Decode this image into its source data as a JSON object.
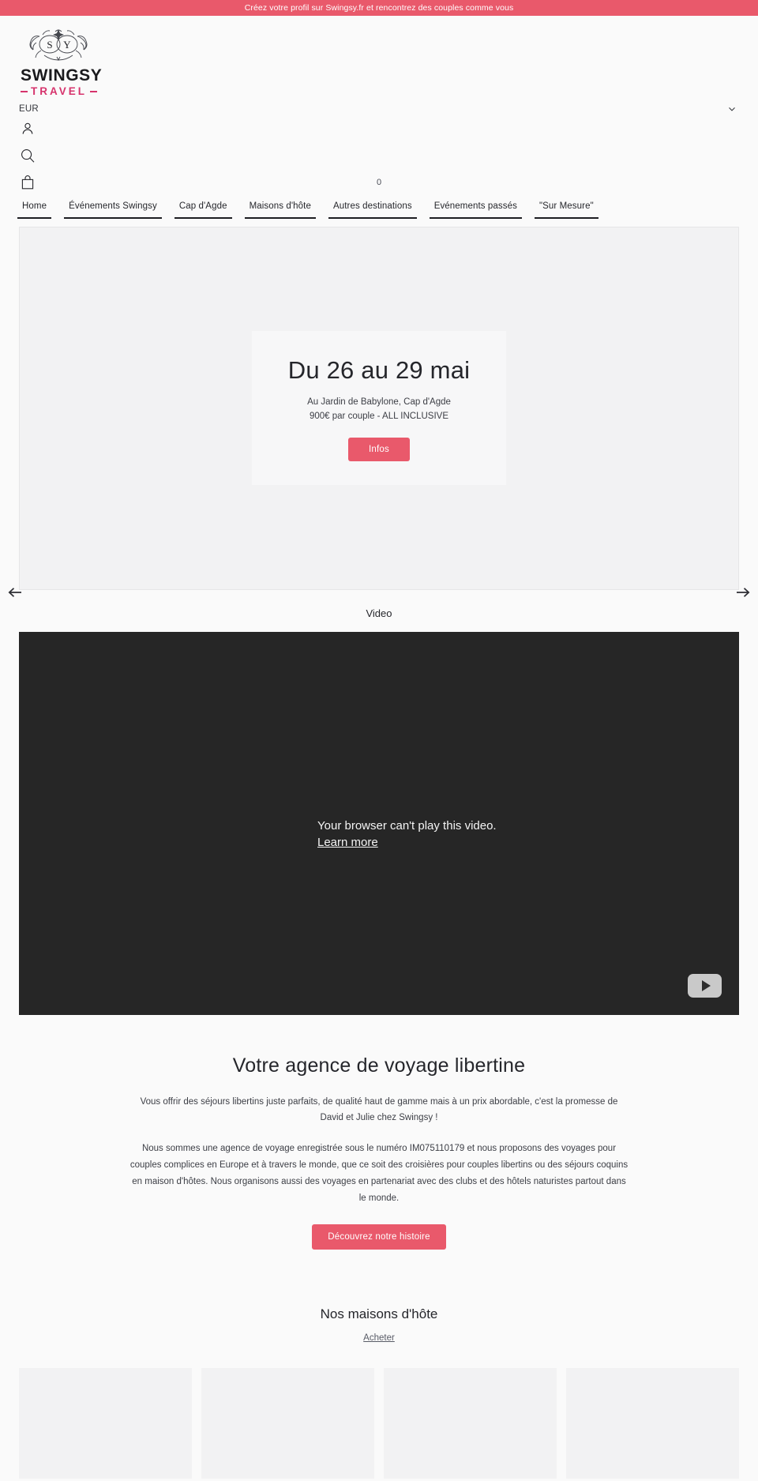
{
  "announcement": {
    "text": "Créez votre profil sur Swingsy.fr et rencontrez des couples comme vous",
    "bg_color": "#e9596b"
  },
  "header": {
    "logo": {
      "emblem_letters": [
        "S",
        "Y"
      ],
      "wordmark": "SWINGSY",
      "subtitle": "TRAVEL",
      "subtitle_color": "#d6336c"
    },
    "currency": {
      "value": "EUR",
      "chevron_icon": "chevron-down-icon"
    },
    "icons": {
      "account": "user-icon",
      "search": "search-icon",
      "cart": "shopping-bag-icon"
    },
    "cart_count": "0"
  },
  "nav": {
    "items": [
      {
        "label": "Home"
      },
      {
        "label": "Événements Swingsy"
      },
      {
        "label": "Cap d'Agde"
      },
      {
        "label": "Maisons d'hôte"
      },
      {
        "label": "Autres destinations"
      },
      {
        "label": "Evénements passés"
      },
      {
        "label": "\"Sur Mesure\""
      }
    ]
  },
  "hero": {
    "prev_icon": "arrow-left-icon",
    "next_icon": "arrow-right-icon",
    "slide": {
      "title": "Du 26 au 29 mai",
      "line1": "Au Jardin de Babylone, Cap d'Agde",
      "line2": "900€ par couple - ALL INCLUSIVE",
      "cta": "Infos",
      "cta_color": "#e9596b"
    }
  },
  "video": {
    "section_label": "Video",
    "error_message": "Your browser can't play this video.",
    "learn_more": "Learn more",
    "play_icon": "youtube-play-icon",
    "bg_color": "#262626"
  },
  "about": {
    "heading": "Votre agence de voyage libertine",
    "paragraph1": "Vous offrir des séjours libertins juste parfaits, de qualité haut de gamme mais à un prix abordable, c'est la promesse de David et Julie chez Swingsy !",
    "paragraph2": "Nous sommes une agence de voyage enregistrée sous le numéro IM075110179 et nous proposons des voyages pour couples complices en Europe et à travers le monde, que ce soit des croisières pour couples libertins ou des séjours coquins en maison d'hôtes. Nous organisons aussi des voyages en partenariat avec des clubs et des hôtels naturistes partout dans le monde.",
    "cta": "Découvrez notre histoire"
  },
  "products": {
    "heading": "Nos maisons d'hôte",
    "shop_link": "Acheter",
    "cards": [
      {
        "placeholder": true
      },
      {
        "placeholder": true
      },
      {
        "placeholder": true
      },
      {
        "placeholder": true
      }
    ]
  }
}
